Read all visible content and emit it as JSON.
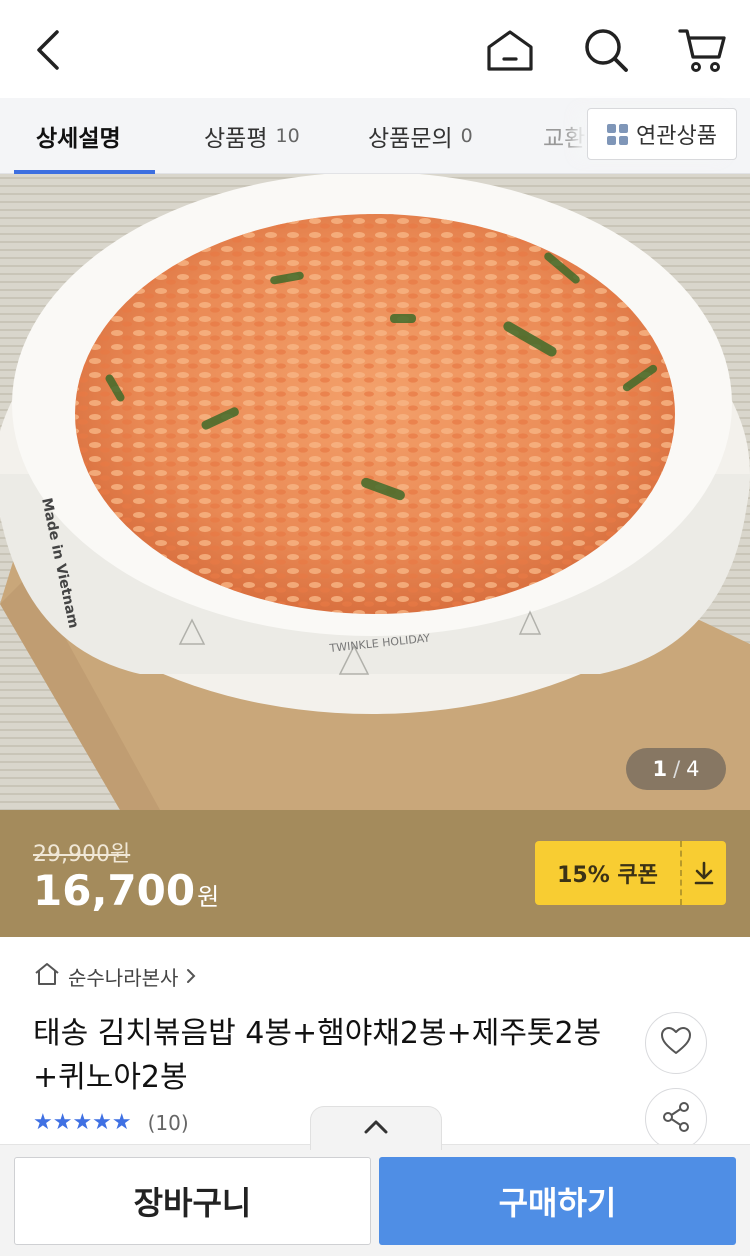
{
  "header": {
    "icons": [
      "back-icon",
      "home-icon",
      "search-icon",
      "cart-icon"
    ]
  },
  "tabs": [
    {
      "label": "상세설명",
      "count": "",
      "active": true
    },
    {
      "label": "상품평",
      "count": "10",
      "active": false
    },
    {
      "label": "상품문의",
      "count": "0",
      "active": false
    },
    {
      "label": "교환",
      "count": "",
      "active": false
    }
  ],
  "related": {
    "label": "연관상품",
    "icon": "grid-icon"
  },
  "hero": {
    "stamp_text": "Made in Vietnam",
    "bowl_text": "TWINKLE HOLIDAY",
    "page_current": "1",
    "page_sep": "/",
    "page_total": "4"
  },
  "price": {
    "original": "29,900원",
    "sale": "16,700",
    "currency": "원",
    "coupon_label": "15% 쿠폰",
    "coupon_icon": "download-icon",
    "band_color": "#a48b5c",
    "coupon_color": "#f8cd32"
  },
  "product": {
    "seller": "순수나라본사",
    "title": "태송 김치볶음밥 4봉+햄야채2봉+제주톳2봉+퀴노아2봉",
    "stars": "★★★★★",
    "rating_count": "(10)"
  },
  "actions": {
    "cart_label": "장바구니",
    "buy_label": "구매하기",
    "buy_color": "#4f8ee5"
  }
}
